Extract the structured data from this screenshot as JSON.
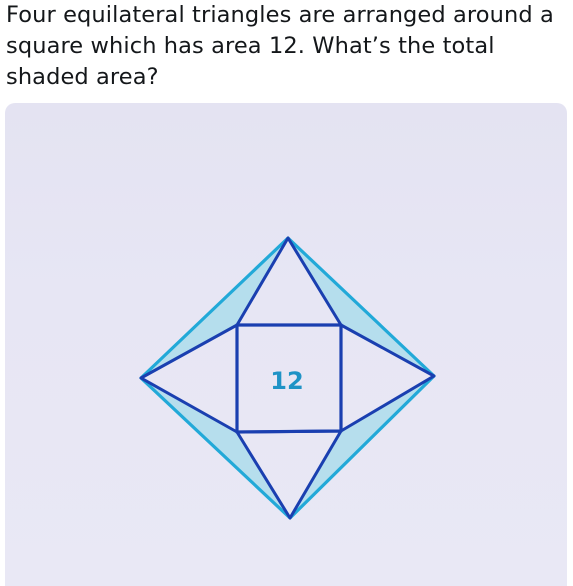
{
  "post": {
    "question_text": "Four equilateral triangles are arranged around a square which has area 12. What’s the total shaded area?"
  },
  "diagram": {
    "square_area_label": "12",
    "colors": {
      "paper": "#e7e6f4",
      "navy_ink": "#1a3fb0",
      "cyan_ink": "#22a9d8",
      "shade_fill": "#a6dcea"
    }
  }
}
